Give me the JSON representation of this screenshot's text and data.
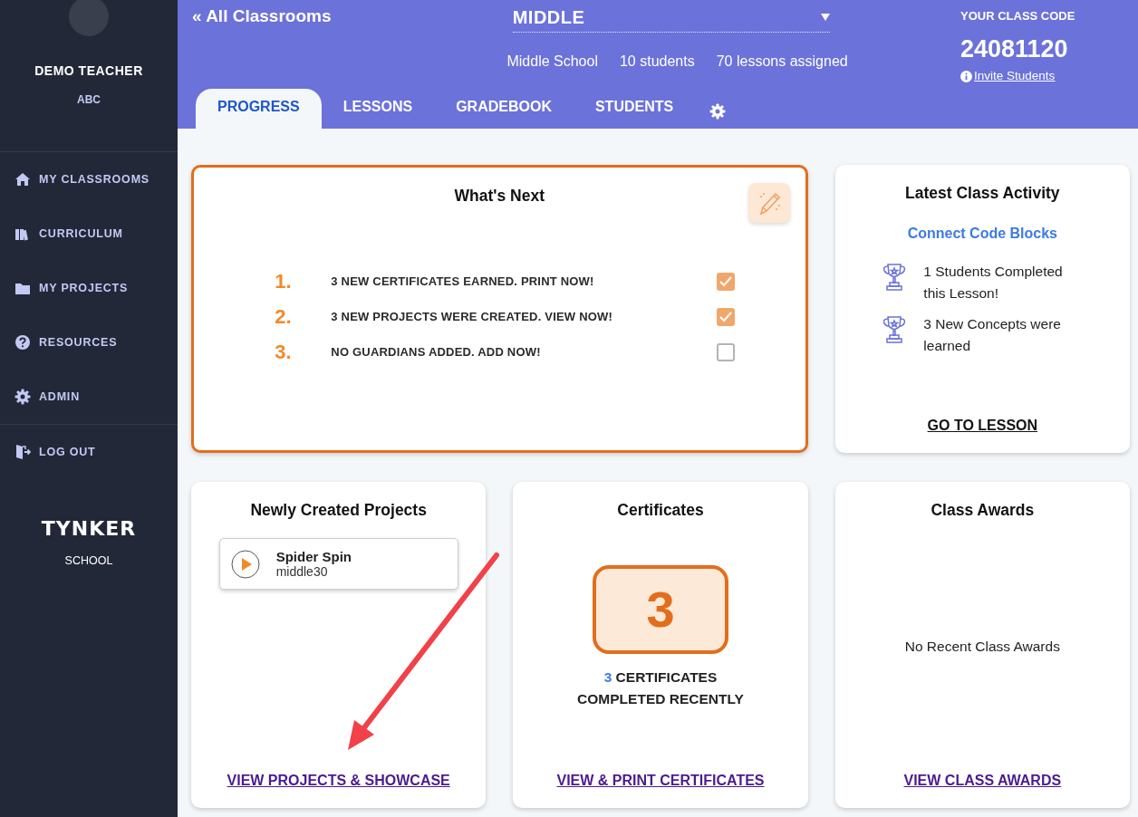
{
  "sidebar": {
    "user_name": "DEMO TEACHER",
    "user_subtitle": "ABC",
    "items": [
      {
        "label": "MY CLASSROOMS"
      },
      {
        "label": "CURRICULUM"
      },
      {
        "label": "MY PROJECTS"
      },
      {
        "label": "RESOURCES"
      },
      {
        "label": "ADMIN"
      }
    ],
    "logout": "LOG OUT",
    "logo": "TYNKER",
    "logo_caption": "SCHOOL"
  },
  "header": {
    "back_link": "« All Classrooms",
    "classroom": "MIDDLE",
    "grade": "Middle School",
    "students_link": "10 students",
    "lessons_link": "70 lessons assigned",
    "code_label": "YOUR CLASS CODE",
    "code": "24081120",
    "invite_link": "Invite Students"
  },
  "tabs": [
    {
      "label": "PROGRESS",
      "selected": true
    },
    {
      "label": "LESSONS",
      "selected": false
    },
    {
      "label": "GRADEBOOK",
      "selected": false
    },
    {
      "label": "STUDENTS",
      "selected": false
    }
  ],
  "whats_next": {
    "title": "What's Next",
    "tasks": [
      {
        "number": "1.",
        "label": "3 NEW CERTIFICATES EARNED. PRINT NOW!",
        "checked": true
      },
      {
        "number": "2.",
        "label": "3 NEW PROJECTS WERE CREATED. VIEW NOW!",
        "checked": true
      },
      {
        "number": "3.",
        "label": "NO GUARDIANS ADDED. ADD NOW!",
        "checked": false
      }
    ]
  },
  "activity": {
    "title": "Latest Class Activity",
    "lesson": "Connect Code Blocks",
    "stats": [
      {
        "text": "1 Students Completed this Lesson!"
      },
      {
        "text": "3 New Concepts were learned"
      }
    ],
    "link": "GO TO LESSON"
  },
  "projects": {
    "title": "Newly Created Projects",
    "items": [
      {
        "name": "Spider Spin",
        "owner": "middle30"
      }
    ],
    "link": "VIEW PROJECTS & SHOWCASE"
  },
  "certificates": {
    "title": "Certificates",
    "count": "3",
    "caption_count": "3",
    "caption_text": "CERTIFICATES COMPLETED RECENTLY",
    "link": "VIEW & PRINT CERTIFICATES"
  },
  "awards": {
    "title": "Class Awards",
    "empty": "No Recent Class Awards",
    "link": "VIEW CLASS AWARDS"
  }
}
